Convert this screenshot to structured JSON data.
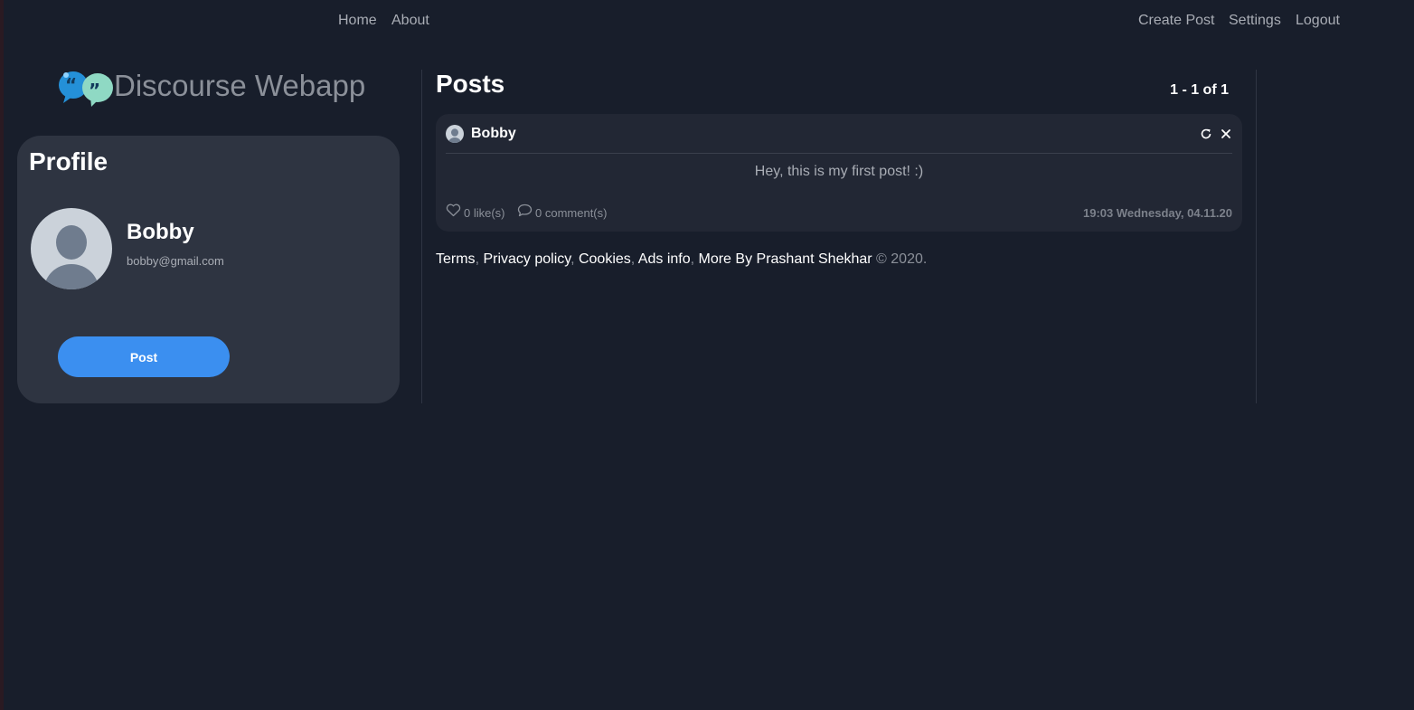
{
  "nav": {
    "left": [
      "Home",
      "About"
    ],
    "right": [
      "Create Post",
      "Settings",
      "Logout"
    ]
  },
  "brand": {
    "title": "Discourse Webapp",
    "logo_icon": "speech-bubbles-quote-icon"
  },
  "profile": {
    "heading": "Profile",
    "name": "Bobby",
    "email": "bobby@gmail.com",
    "post_button_label": "Post"
  },
  "posts": {
    "heading": "Posts",
    "pagination": "1 - 1 of 1",
    "items": [
      {
        "author": "Bobby",
        "body": "Hey, this is my first post! :)",
        "likes": "0 like(s)",
        "comments": "0 comment(s)",
        "timestamp": "19:03 Wednesday, 04.11.20"
      }
    ]
  },
  "footer": {
    "links": [
      "Terms",
      "Privacy policy",
      "Cookies",
      "Ads info",
      "More By Prashant Shekhar"
    ],
    "copyright": "© 2020."
  },
  "colors": {
    "background": "#181e2b",
    "card": "#2e3441",
    "post_card": "#222734",
    "accent": "#3b8ff0",
    "muted_text": "#a9adb5"
  }
}
